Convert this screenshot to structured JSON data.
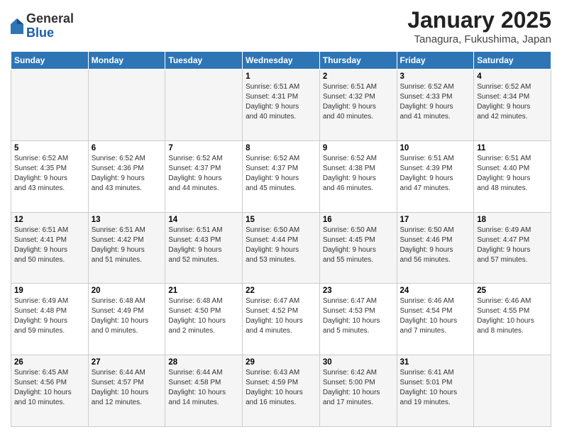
{
  "header": {
    "logo": {
      "general": "General",
      "blue": "Blue"
    },
    "title": "January 2025",
    "subtitle": "Tanagura, Fukushima, Japan"
  },
  "weekdays": [
    "Sunday",
    "Monday",
    "Tuesday",
    "Wednesday",
    "Thursday",
    "Friday",
    "Saturday"
  ],
  "weeks": [
    [
      {
        "day": "",
        "info": ""
      },
      {
        "day": "",
        "info": ""
      },
      {
        "day": "",
        "info": ""
      },
      {
        "day": "1",
        "info": "Sunrise: 6:51 AM\nSunset: 4:31 PM\nDaylight: 9 hours\nand 40 minutes."
      },
      {
        "day": "2",
        "info": "Sunrise: 6:51 AM\nSunset: 4:32 PM\nDaylight: 9 hours\nand 40 minutes."
      },
      {
        "day": "3",
        "info": "Sunrise: 6:52 AM\nSunset: 4:33 PM\nDaylight: 9 hours\nand 41 minutes."
      },
      {
        "day": "4",
        "info": "Sunrise: 6:52 AM\nSunset: 4:34 PM\nDaylight: 9 hours\nand 42 minutes."
      }
    ],
    [
      {
        "day": "5",
        "info": "Sunrise: 6:52 AM\nSunset: 4:35 PM\nDaylight: 9 hours\nand 43 minutes."
      },
      {
        "day": "6",
        "info": "Sunrise: 6:52 AM\nSunset: 4:36 PM\nDaylight: 9 hours\nand 43 minutes."
      },
      {
        "day": "7",
        "info": "Sunrise: 6:52 AM\nSunset: 4:37 PM\nDaylight: 9 hours\nand 44 minutes."
      },
      {
        "day": "8",
        "info": "Sunrise: 6:52 AM\nSunset: 4:37 PM\nDaylight: 9 hours\nand 45 minutes."
      },
      {
        "day": "9",
        "info": "Sunrise: 6:52 AM\nSunset: 4:38 PM\nDaylight: 9 hours\nand 46 minutes."
      },
      {
        "day": "10",
        "info": "Sunrise: 6:51 AM\nSunset: 4:39 PM\nDaylight: 9 hours\nand 47 minutes."
      },
      {
        "day": "11",
        "info": "Sunrise: 6:51 AM\nSunset: 4:40 PM\nDaylight: 9 hours\nand 48 minutes."
      }
    ],
    [
      {
        "day": "12",
        "info": "Sunrise: 6:51 AM\nSunset: 4:41 PM\nDaylight: 9 hours\nand 50 minutes."
      },
      {
        "day": "13",
        "info": "Sunrise: 6:51 AM\nSunset: 4:42 PM\nDaylight: 9 hours\nand 51 minutes."
      },
      {
        "day": "14",
        "info": "Sunrise: 6:51 AM\nSunset: 4:43 PM\nDaylight: 9 hours\nand 52 minutes."
      },
      {
        "day": "15",
        "info": "Sunrise: 6:50 AM\nSunset: 4:44 PM\nDaylight: 9 hours\nand 53 minutes."
      },
      {
        "day": "16",
        "info": "Sunrise: 6:50 AM\nSunset: 4:45 PM\nDaylight: 9 hours\nand 55 minutes."
      },
      {
        "day": "17",
        "info": "Sunrise: 6:50 AM\nSunset: 4:46 PM\nDaylight: 9 hours\nand 56 minutes."
      },
      {
        "day": "18",
        "info": "Sunrise: 6:49 AM\nSunset: 4:47 PM\nDaylight: 9 hours\nand 57 minutes."
      }
    ],
    [
      {
        "day": "19",
        "info": "Sunrise: 6:49 AM\nSunset: 4:48 PM\nDaylight: 9 hours\nand 59 minutes."
      },
      {
        "day": "20",
        "info": "Sunrise: 6:48 AM\nSunset: 4:49 PM\nDaylight: 10 hours\nand 0 minutes."
      },
      {
        "day": "21",
        "info": "Sunrise: 6:48 AM\nSunset: 4:50 PM\nDaylight: 10 hours\nand 2 minutes."
      },
      {
        "day": "22",
        "info": "Sunrise: 6:47 AM\nSunset: 4:52 PM\nDaylight: 10 hours\nand 4 minutes."
      },
      {
        "day": "23",
        "info": "Sunrise: 6:47 AM\nSunset: 4:53 PM\nDaylight: 10 hours\nand 5 minutes."
      },
      {
        "day": "24",
        "info": "Sunrise: 6:46 AM\nSunset: 4:54 PM\nDaylight: 10 hours\nand 7 minutes."
      },
      {
        "day": "25",
        "info": "Sunrise: 6:46 AM\nSunset: 4:55 PM\nDaylight: 10 hours\nand 8 minutes."
      }
    ],
    [
      {
        "day": "26",
        "info": "Sunrise: 6:45 AM\nSunset: 4:56 PM\nDaylight: 10 hours\nand 10 minutes."
      },
      {
        "day": "27",
        "info": "Sunrise: 6:44 AM\nSunset: 4:57 PM\nDaylight: 10 hours\nand 12 minutes."
      },
      {
        "day": "28",
        "info": "Sunrise: 6:44 AM\nSunset: 4:58 PM\nDaylight: 10 hours\nand 14 minutes."
      },
      {
        "day": "29",
        "info": "Sunrise: 6:43 AM\nSunset: 4:59 PM\nDaylight: 10 hours\nand 16 minutes."
      },
      {
        "day": "30",
        "info": "Sunrise: 6:42 AM\nSunset: 5:00 PM\nDaylight: 10 hours\nand 17 minutes."
      },
      {
        "day": "31",
        "info": "Sunrise: 6:41 AM\nSunset: 5:01 PM\nDaylight: 10 hours\nand 19 minutes."
      },
      {
        "day": "",
        "info": ""
      }
    ]
  ]
}
